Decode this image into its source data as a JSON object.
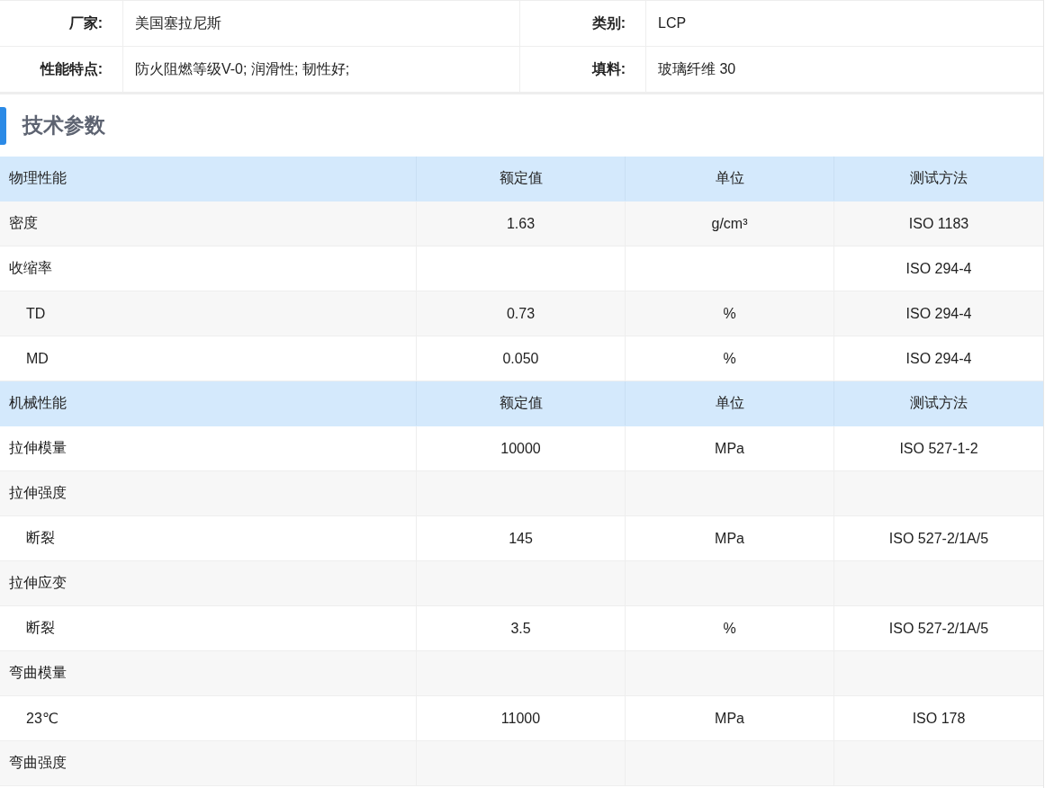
{
  "info": [
    {
      "label": "厂家:",
      "value": "美国塞拉尼斯",
      "label2": "类别:",
      "value2": "LCP"
    },
    {
      "label": "性能特点:",
      "value": "防火阻燃等级V-0; 润滑性; 韧性好;",
      "label2": "填料:",
      "value2": "玻璃纤维 30"
    }
  ],
  "section_title": "技术参数",
  "groups": [
    {
      "header": [
        "物理性能",
        "额定值",
        "单位",
        "测试方法"
      ],
      "rows": [
        {
          "cells": [
            "密度",
            "1.63",
            "g/cm³",
            "ISO 1183"
          ]
        },
        {
          "cells": [
            "收缩率",
            "",
            "",
            "ISO 294-4"
          ],
          "children": [
            {
              "cells": [
                "TD",
                "0.73",
                "%",
                "ISO 294-4"
              ]
            },
            {
              "cells": [
                "MD",
                "0.050",
                "%",
                "ISO 294-4"
              ]
            }
          ]
        }
      ]
    },
    {
      "header": [
        "机械性能",
        "额定值",
        "单位",
        "测试方法"
      ],
      "rows": [
        {
          "cells": [
            "拉伸模量",
            "10000",
            "MPa",
            "ISO 527-1-2"
          ]
        },
        {
          "cells": [
            "拉伸强度",
            "",
            "",
            ""
          ],
          "children": [
            {
              "cells": [
                "断裂",
                "145",
                "MPa",
                "ISO 527-2/1A/5"
              ]
            }
          ]
        },
        {
          "cells": [
            "拉伸应变",
            "",
            "",
            ""
          ],
          "children": [
            {
              "cells": [
                "断裂",
                "3.5",
                "%",
                "ISO 527-2/1A/5"
              ]
            }
          ]
        },
        {
          "cells": [
            "弯曲模量",
            "",
            "",
            ""
          ],
          "children": [
            {
              "cells": [
                "23℃",
                "11000",
                "MPa",
                "ISO 178"
              ]
            }
          ]
        },
        {
          "cells": [
            "弯曲强度",
            "",
            "",
            ""
          ]
        }
      ]
    }
  ]
}
